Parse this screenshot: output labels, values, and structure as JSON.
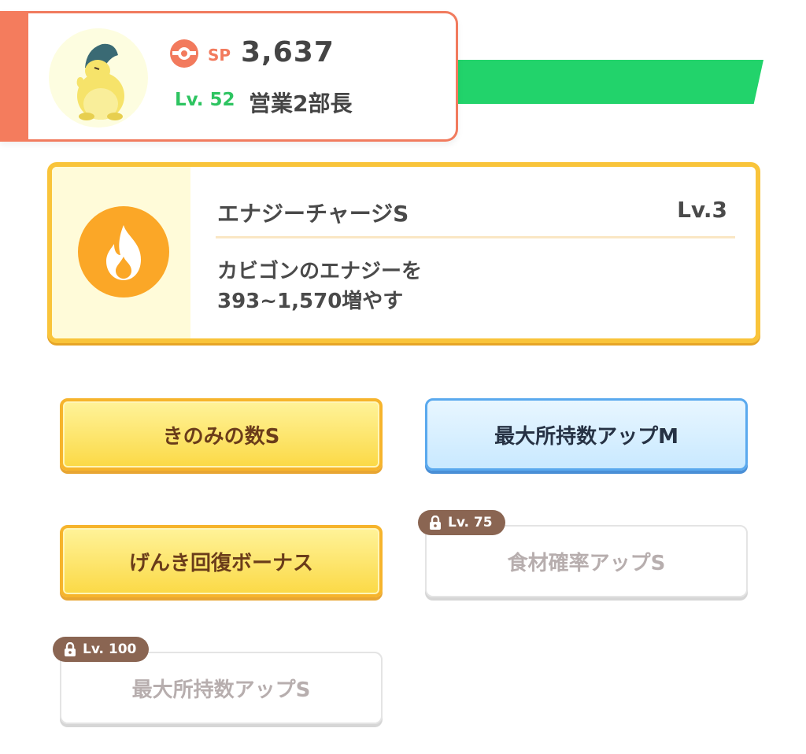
{
  "header": {
    "sp_label": "SP",
    "sp_value": "3,637",
    "level_label": "Lv. 52",
    "rank_title": "営業2部長",
    "colors": {
      "accent": "#f47c5d",
      "stripe": "#22d36b",
      "level": "#2ec461"
    },
    "avatar_icon": "pokemon-avatar-icon",
    "sp_icon": "pokeball-icon"
  },
  "main_skill": {
    "name": "エナジーチャージS",
    "level": "Lv.3",
    "description_line1": "カビゴンのエナジーを",
    "description_line2": "393~1,570増やす",
    "icon": "flame-icon",
    "colors": {
      "border": "#f9c43a",
      "icon_bg": "#fba727"
    }
  },
  "sub_skills": [
    {
      "label": "きのみの数S",
      "style": "gold",
      "locked": false
    },
    {
      "label": "最大所持数アップM",
      "style": "blue",
      "locked": false
    },
    {
      "label": "げんき回復ボーナス",
      "style": "gold",
      "locked": false
    },
    {
      "label": "食材確率アップS",
      "style": "locked",
      "locked": true,
      "unlock_level": "Lv. 75"
    },
    {
      "label": "最大所持数アップS",
      "style": "locked",
      "locked": true,
      "unlock_level": "Lv. 100"
    }
  ]
}
